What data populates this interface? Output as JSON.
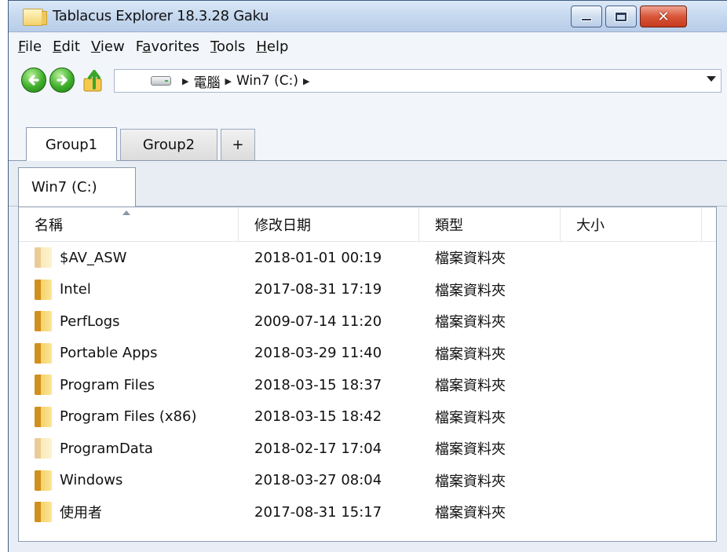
{
  "window": {
    "title": "Tablacus Explorer 18.3.28 Gaku",
    "close_glyph": "✕"
  },
  "menu": [
    {
      "label": "File",
      "key": "F",
      "rest": "ile"
    },
    {
      "label": "Edit",
      "key": "E",
      "rest": "dit"
    },
    {
      "label": "View",
      "key": "V",
      "rest": "iew"
    },
    {
      "label": "Favorites",
      "pre": "F",
      "key": "a",
      "rest": "vorites"
    },
    {
      "label": "Tools",
      "key": "T",
      "rest": "ools"
    },
    {
      "label": "Help",
      "key": "H",
      "rest": "elp"
    }
  ],
  "address": {
    "crumbs": [
      "電腦",
      "Win7 (C:)"
    ],
    "separator": "▶"
  },
  "group_tabs": [
    "Group1",
    "Group2",
    "+"
  ],
  "folder_tab": "Win7 (C:)",
  "columns": [
    "名稱",
    "修改日期",
    "類型",
    "大小"
  ],
  "files": [
    {
      "name": "$AV_ASW",
      "date": "2018-01-01 00:19",
      "type": "檔案資料夾",
      "faded": true
    },
    {
      "name": "Intel",
      "date": "2017-08-31 17:19",
      "type": "檔案資料夾",
      "faded": false
    },
    {
      "name": "PerfLogs",
      "date": "2009-07-14 11:20",
      "type": "檔案資料夾",
      "faded": false
    },
    {
      "name": "Portable Apps",
      "date": "2018-03-29 11:40",
      "type": "檔案資料夾",
      "faded": false
    },
    {
      "name": "Program Files",
      "date": "2018-03-15 18:37",
      "type": "檔案資料夾",
      "faded": false
    },
    {
      "name": "Program Files (x86)",
      "date": "2018-03-15 18:42",
      "type": "檔案資料夾",
      "faded": false
    },
    {
      "name": "ProgramData",
      "date": "2018-02-17 17:04",
      "type": "檔案資料夾",
      "faded": true
    },
    {
      "name": "Windows",
      "date": "2018-03-27 08:04",
      "type": "檔案資料夾",
      "faded": false
    },
    {
      "name": "使用者",
      "date": "2017-08-31 15:17",
      "type": "檔案資料夾",
      "faded": false
    }
  ]
}
